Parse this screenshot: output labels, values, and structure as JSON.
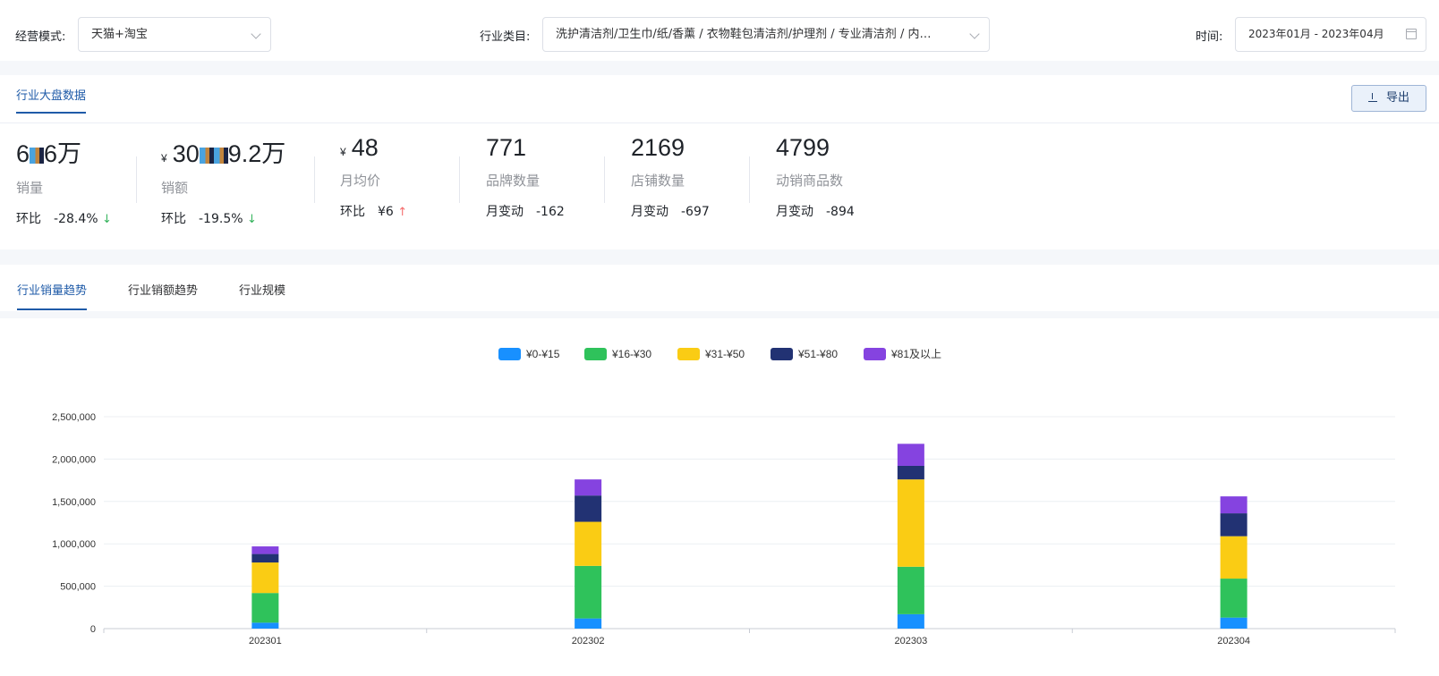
{
  "filters": {
    "mode_label": "经营模式:",
    "mode_value": "天猫+淘宝",
    "category_label": "行业类目:",
    "category_value": "洗护清洁剂/卫生巾/纸/香薰 / 衣物鞋包清洁剂/护理剂 / 专业清洁剂 / 内…",
    "time_label": "时间:",
    "time_value": "2023年01月 - 2023年04月"
  },
  "panel": {
    "tab": "行业大盘数据",
    "export_label": "导出"
  },
  "kpis": [
    {
      "value_a": "6",
      "value_b": "6万",
      "currency": "",
      "label": "销量",
      "change_label": "环比",
      "change_value": "-28.4%",
      "arrow": "↓"
    },
    {
      "value_a": "30",
      "value_b": "9.2万",
      "currency": "¥",
      "label": "销额",
      "change_label": "环比",
      "change_value": "-19.5%",
      "arrow": "↓"
    },
    {
      "value": "48",
      "currency": "¥",
      "label": "月均价",
      "change_label": "环比",
      "change_value": "¥6",
      "arrow": "↑"
    },
    {
      "value": "771",
      "label": "品牌数量",
      "change_label": "月变动",
      "change_value": "-162"
    },
    {
      "value": "2169",
      "label": "店铺数量",
      "change_label": "月变动",
      "change_value": "-697"
    },
    {
      "value": "4799",
      "label": "动销商品数",
      "change_label": "月变动",
      "change_value": "-894"
    }
  ],
  "trend_tabs": [
    "行业销量趋势",
    "行业销额趋势",
    "行业规模"
  ],
  "chart_data": {
    "type": "bar",
    "stacked": true,
    "categories": [
      "202301",
      "202302",
      "202303",
      "202304"
    ],
    "series": [
      {
        "name": "¥0-¥15",
        "color": "#1890ff",
        "values": [
          70000,
          120000,
          170000,
          130000
        ]
      },
      {
        "name": "¥16-¥30",
        "color": "#2fc25b",
        "values": [
          350000,
          620000,
          560000,
          460000
        ]
      },
      {
        "name": "¥31-¥50",
        "color": "#facc14",
        "values": [
          360000,
          520000,
          1030000,
          500000
        ]
      },
      {
        "name": "¥51-¥80",
        "color": "#223273",
        "values": [
          100000,
          310000,
          160000,
          270000
        ]
      },
      {
        "name": "¥81及以上",
        "color": "#8543e0",
        "values": [
          90000,
          190000,
          260000,
          200000
        ]
      }
    ],
    "ylim": [
      0,
      2500000
    ],
    "yticks": [
      0,
      500000,
      1000000,
      1500000,
      2000000,
      2500000
    ],
    "ytick_labels": [
      "0",
      "500,000",
      "1,000,000",
      "1,500,000",
      "2,000,000",
      "2,500,000"
    ],
    "legend_position": "top-center",
    "grid": true
  }
}
